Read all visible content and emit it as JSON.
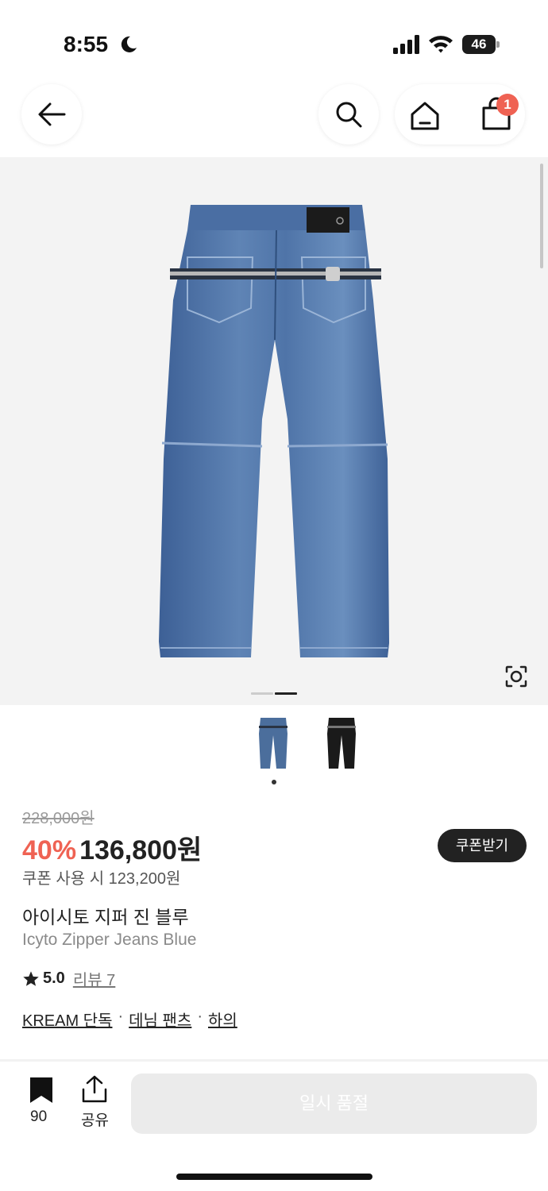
{
  "status_bar": {
    "time": "8:55",
    "battery": "46"
  },
  "nav": {
    "cart_count": "1"
  },
  "product": {
    "original_price": "228,000원",
    "discount": "40%",
    "price": "136,800원",
    "coupon_button": "쿠폰받기",
    "coupon_price": "쿠폰 사용 시 123,200원",
    "name_ko": "아이시토 지퍼 진 블루",
    "name_en": "Icyto Zipper Jeans Blue",
    "rating": "5.0",
    "review_link": "리뷰 7",
    "tags": [
      "KREAM 단독",
      "데님 팬츠",
      "하의"
    ],
    "tag_separator": "·",
    "image_count": 2,
    "active_image": 2,
    "thumbnails": [
      "blue-jeans",
      "black-jeans"
    ]
  },
  "bottom_bar": {
    "bookmark_count": "90",
    "share_label": "공유",
    "soldout_label": "일시 품절"
  },
  "colors": {
    "accent": "#ef6253",
    "denim": "#4b6e9c",
    "button_dark": "#222222",
    "disabled": "#ebebeb"
  },
  "icons": [
    "moon-icon",
    "signal-icon",
    "wifi-icon",
    "battery-icon",
    "back-arrow-icon",
    "search-icon",
    "home-icon",
    "cart-icon",
    "lens-icon",
    "star-icon",
    "bookmark-icon",
    "share-icon"
  ]
}
